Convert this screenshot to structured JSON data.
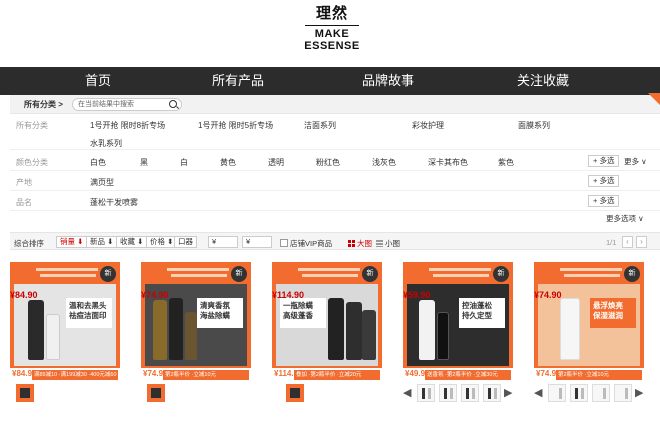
{
  "brand": {
    "cn": "理然",
    "en_line1": "MAKE",
    "en_line2": "ESSENSE"
  },
  "nav": [
    {
      "label": "首页"
    },
    {
      "label": "所有产品"
    },
    {
      "label": "品牌故事"
    },
    {
      "label": "关注收藏"
    }
  ],
  "search": {
    "all_categories": "所有分类 >",
    "placeholder": "在当前结果中搜索"
  },
  "filters": {
    "category": {
      "label": "所有分类",
      "row1": [
        "1号开抢 限时8折专场",
        "1号开抢 限时5折专场",
        "洁面系列",
        "彩妆护理",
        "面膜系列"
      ],
      "row2": [
        "水乳系列"
      ]
    },
    "color": {
      "label": "颜色分类",
      "values": [
        "白色",
        "黑",
        "白",
        "黄色",
        "透明",
        "粉红色",
        "浅灰色",
        "深卡其布色",
        "紫色"
      ],
      "multi": "+ 多选",
      "more": "更多 ∨"
    },
    "origin": {
      "label": "产地",
      "value": "满页型",
      "multi": "+ 多选"
    },
    "product_name": {
      "label": "品名",
      "value": "蓬松干发喷雾",
      "multi": "+ 多选"
    },
    "more_options": "更多选项 ∨"
  },
  "sortbar": {
    "general": "综合排序",
    "sales": "销量 ⬇",
    "new": "新品 ⬇",
    "favorites": "收藏 ⬇",
    "price": "价格 ⬍",
    "price_range": "口器",
    "min_price": "¥",
    "max_price": "¥",
    "vip": "店铺VIP商品",
    "big_view": "大图",
    "small_view": "小图",
    "page": "1/1"
  },
  "products": [
    {
      "price": "¥84.90",
      "strip_price": "¥84.9",
      "strip_text": "满89减10 ·满199减30 ·400元减60",
      "panel": "温和去黑头\n祛痘洁面印",
      "badge": "新"
    },
    {
      "price": "¥74.90",
      "strip_price": "¥74.9",
      "strip_text": "第2瓶半价 ·立减10元",
      "panel": "清爽香氛\n海盐除螨",
      "badge": "新"
    },
    {
      "price": "¥114.90",
      "strip_price": "¥114.9",
      "strip_text": "叠加 ·第2瓶半价 ·立减20元",
      "panel": "一瓶除螨\n高级蓬香",
      "badge": "新"
    },
    {
      "price": "¥59.90",
      "strip_price": "¥49.9",
      "strip_text": "送香氛 ·第2瓶半价 ·立减30元",
      "panel": "控油蓬松\n持久定型",
      "badge": "新"
    },
    {
      "price": "¥74.90",
      "strip_price": "¥74.9",
      "strip_text": "第2瓶半价 ·立减10元",
      "panel": "悬浮焕亮\n保湿滋润",
      "badge": "新"
    }
  ],
  "colors": {
    "accent": "#f26c2f",
    "nav_bg": "#2c2c2c",
    "price": "#cc0000"
  }
}
